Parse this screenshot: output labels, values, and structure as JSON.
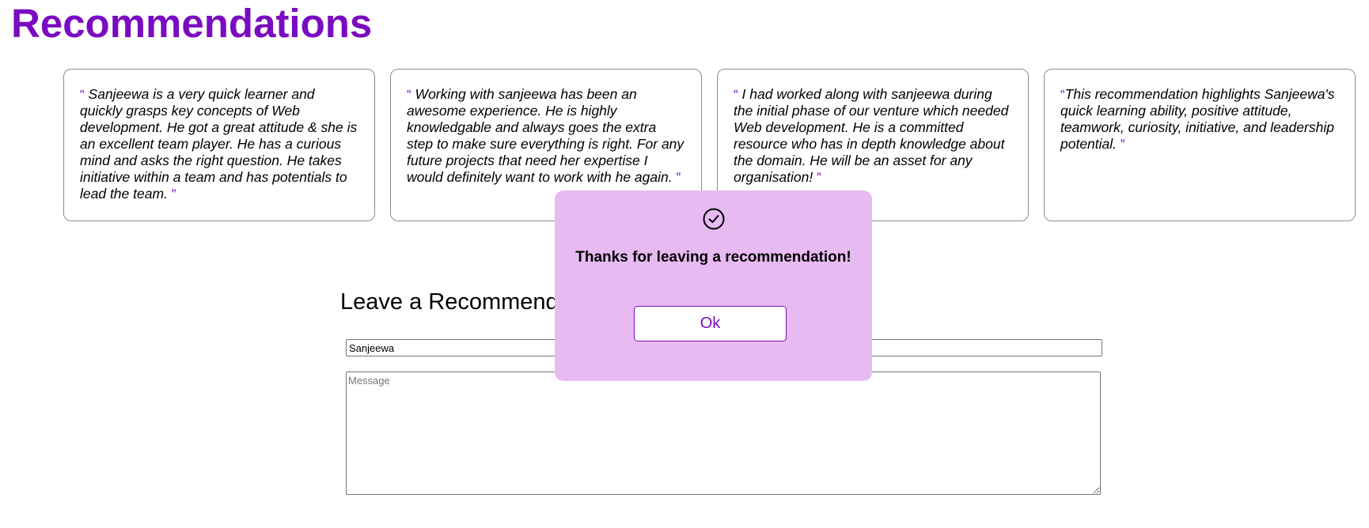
{
  "page": {
    "title": "Recommendations"
  },
  "recommendations": [
    {
      "open_quote": "“",
      "text": "Sanjeewa is a very quick learner and quickly grasps key concepts of Web development. He got a great attitude & she is an excellent team player. He has a curious mind and asks the right question. He takes initiative within a team and has potentials to lead the team.",
      "close_quote": "”"
    },
    {
      "open_quote": "“",
      "text": "Working with sanjeewa has been an awesome experience. He is highly knowledgable and always goes the extra step to make sure everything is right. For any future projects that need her expertise I would definitely want to work with he again.",
      "close_quote": "”"
    },
    {
      "open_quote": "“",
      "text": "I had worked along with sanjeewa during the initial phase of our venture which needed Web development. He is a committed resource who has in depth knowledge about the domain. He will be an asset for any organisation!",
      "close_quote": "”"
    },
    {
      "open_quote": "“",
      "text": "This recommendation highlights Sanjeewa's quick learning ability, positive attitude, teamwork, curiosity, initiative, and leadership potential.",
      "close_quote": "”"
    }
  ],
  "form": {
    "heading": "Leave a Recommendation",
    "name_value": "Sanjeewa",
    "message_placeholder": "Message",
    "message_value": ""
  },
  "popup": {
    "icon": "check-circle-icon",
    "message": "Thanks for leaving a recommendation!",
    "ok_label": "Ok"
  },
  "colors": {
    "accent": "#7a0bc0",
    "popup_background": "#e7baf1",
    "card_border": "#8c8c8c"
  }
}
